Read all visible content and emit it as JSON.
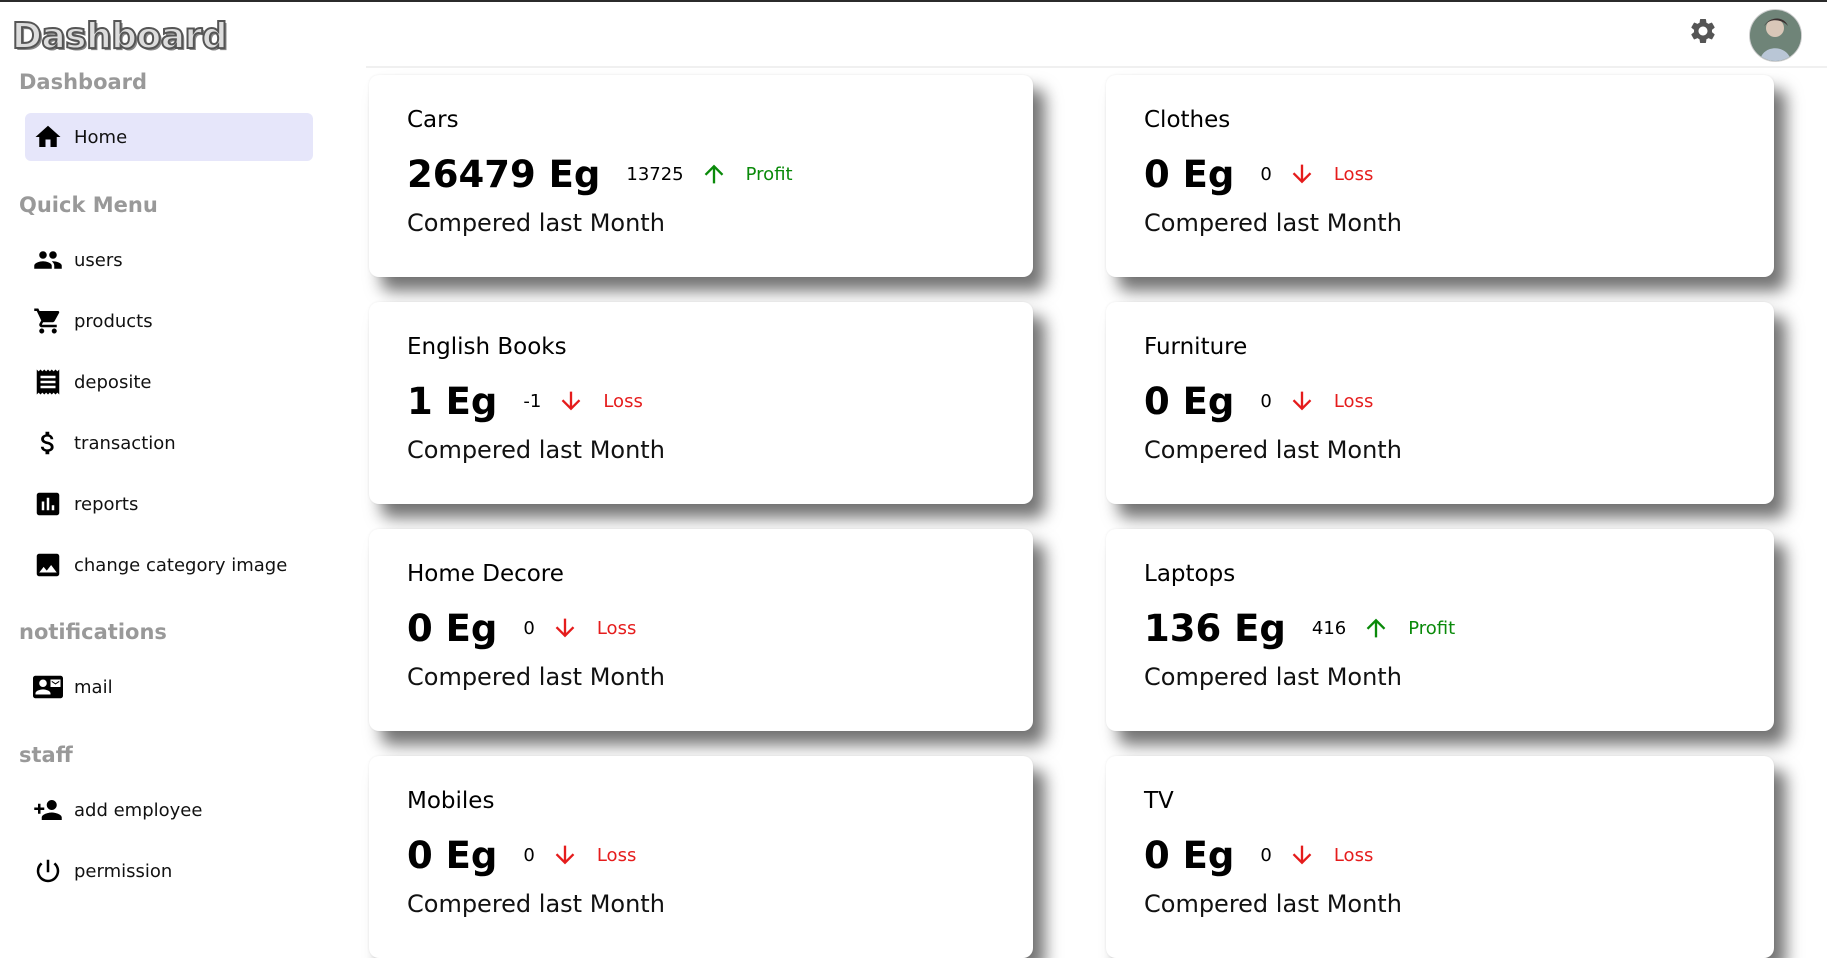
{
  "header": {
    "logo": "Dashboard",
    "settings_icon": "gear-icon",
    "avatar_icon": "user-avatar"
  },
  "colors": {
    "active_bg": "#e6e6fa",
    "profit": "#0a8a0a",
    "loss": "#e51c1c",
    "section": "#999999"
  },
  "sidebar": {
    "sections": [
      {
        "title": "Dashboard",
        "items": [
          {
            "label": "Home",
            "icon": "home-icon",
            "active": true
          }
        ]
      },
      {
        "title": "Quick Menu",
        "items": [
          {
            "label": "users",
            "icon": "users-icon"
          },
          {
            "label": "products",
            "icon": "cart-icon"
          },
          {
            "label": "deposite",
            "icon": "receipt-icon"
          },
          {
            "label": "transaction",
            "icon": "dollar-icon"
          },
          {
            "label": "reports",
            "icon": "bar-chart-icon"
          },
          {
            "label": "change category image",
            "icon": "image-icon"
          }
        ]
      },
      {
        "title": "notifications",
        "items": [
          {
            "label": "mail",
            "icon": "contact-mail-icon"
          }
        ]
      },
      {
        "title": "staff",
        "items": [
          {
            "label": "add employee",
            "icon": "person-add-icon"
          },
          {
            "label": "permission",
            "icon": "power-icon"
          }
        ]
      }
    ]
  },
  "cards": [
    {
      "title": "Cars",
      "amount": "26479 Eg",
      "diff": "13725",
      "trend": "up",
      "status": "Profit",
      "subtitle": "Compered last Month"
    },
    {
      "title": "Clothes",
      "amount": "0 Eg",
      "diff": "0",
      "trend": "down",
      "status": "Loss",
      "subtitle": "Compered last Month"
    },
    {
      "title": "English Books",
      "amount": "1 Eg",
      "diff": "-1",
      "trend": "down",
      "status": "Loss",
      "subtitle": "Compered last Month"
    },
    {
      "title": "Furniture",
      "amount": "0 Eg",
      "diff": "0",
      "trend": "down",
      "status": "Loss",
      "subtitle": "Compered last Month"
    },
    {
      "title": "Home Decore",
      "amount": "0 Eg",
      "diff": "0",
      "trend": "down",
      "status": "Loss",
      "subtitle": "Compered last Month"
    },
    {
      "title": "Laptops",
      "amount": "136 Eg",
      "diff": "416",
      "trend": "up",
      "status": "Profit",
      "subtitle": "Compered last Month"
    },
    {
      "title": "Mobiles",
      "amount": "0 Eg",
      "diff": "0",
      "trend": "down",
      "status": "Loss",
      "subtitle": "Compered last Month"
    },
    {
      "title": "TV",
      "amount": "0 Eg",
      "diff": "0",
      "trend": "down",
      "status": "Loss",
      "subtitle": "Compered last Month"
    }
  ]
}
